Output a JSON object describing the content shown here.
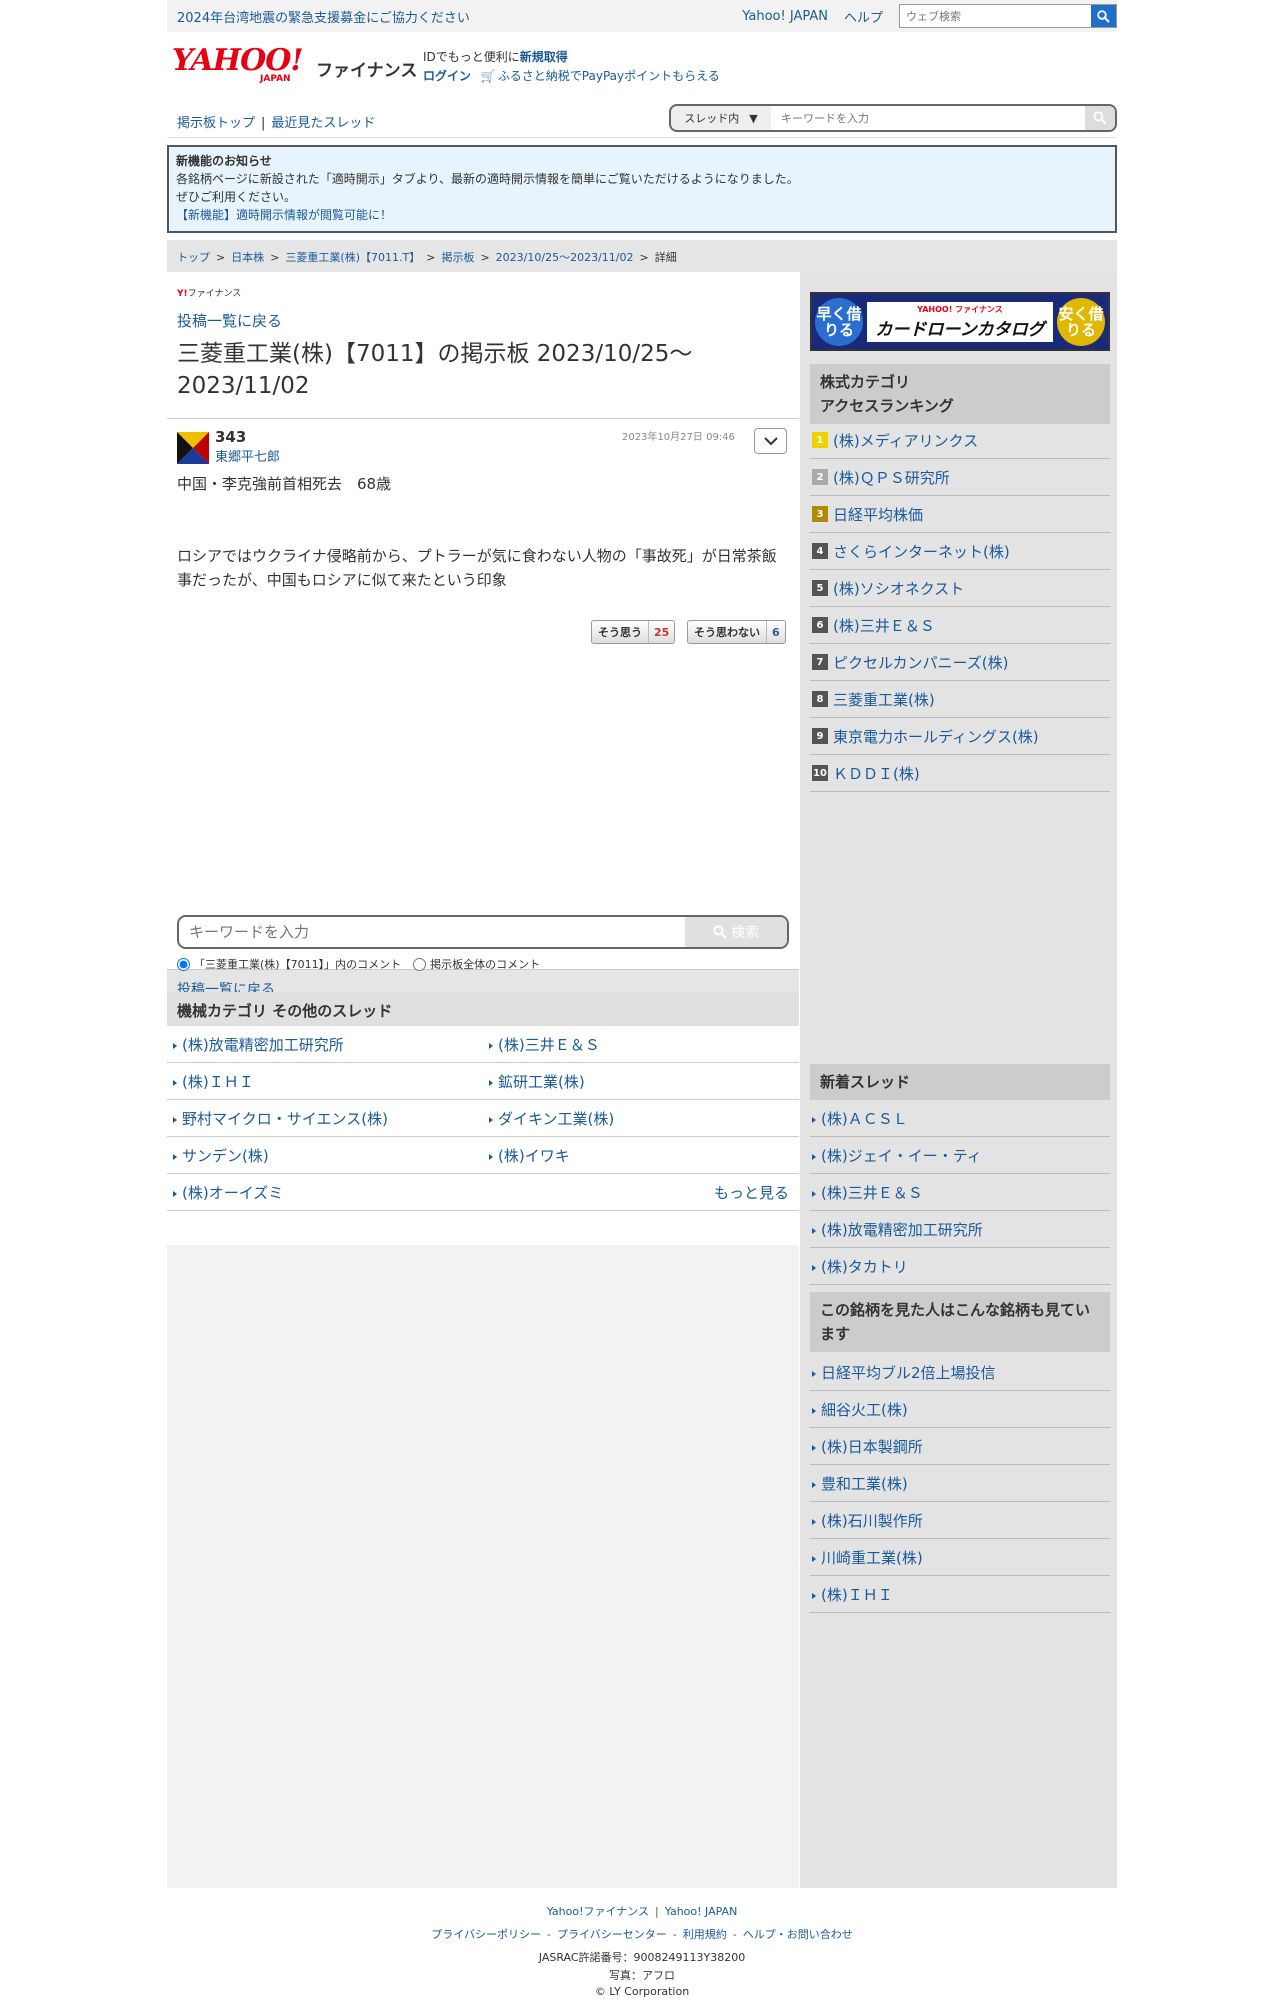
{
  "topbar": {
    "notice": "2024年台湾地震の緊急支援募金にご協力ください",
    "links": [
      "Yahoo! JAPAN",
      "ヘルプ"
    ],
    "search_placeholder": "ウェブ検索"
  },
  "header": {
    "logo_main": "YAHOO!",
    "logo_sub": "JAPAN",
    "logo_service": "ファイナンス",
    "id_text": "IDでもっと便利に",
    "signup": "新規取得",
    "login": "ログイン",
    "furusato": "ふるさと納税でPayPayポイントもらえる"
  },
  "boardnav": {
    "top": "掲示板トップ",
    "recent": "最近見たスレッド",
    "scope": "スレッド内",
    "search_placeholder": "キーワードを入力"
  },
  "announce": {
    "title": "新機能のお知らせ",
    "line1": "各銘柄ページに新設された「適時開示」タブより、最新の適時開示情報を簡単にご覧いただけるようになりました。",
    "line2": "ぜひご利用ください。",
    "link": "【新機能】適時開示情報が閲覧可能に！"
  },
  "breadcrumb": [
    "トップ",
    "日本株",
    "三菱重工業(株)【7011.T】",
    "掲示板",
    "2023/10/25〜2023/11/02",
    "詳細"
  ],
  "main": {
    "small_logo_y": "Y!",
    "small_logo_text": "ファイナンス",
    "back_link": "投稿一覧に戻る",
    "thread_title": "三菱重工業(株)【7011】の掲示板 2023/10/25〜2023/11/02"
  },
  "post": {
    "number": "343",
    "user": "東郷平七郎",
    "date": "2023年10月27日 09:46",
    "line1": "中国・李克強前首相死去　68歳",
    "body": "ロシアではウクライナ侵略前から、プトラーが気に食わない人物の「事故死」が日常茶飯事だったが、中国もロシアに似て来たという印象",
    "agree_label": "そう思う",
    "agree_count": "25",
    "disagree_label": "そう思わない",
    "disagree_count": "6"
  },
  "back_bar": "投稿一覧に戻る",
  "comment_search": {
    "placeholder": "キーワードを入力",
    "button": "検索",
    "radio1": "「三菱重工業(株)【7011】」内のコメント",
    "radio2": "掲示板全体のコメント"
  },
  "other_threads": {
    "heading": "機械カテゴリ  その他のスレッド",
    "items": [
      "(株)放電精密加工研究所",
      "(株)三井Ｅ＆Ｓ",
      "(株)ＩＨＩ",
      "鉱研工業(株)",
      "野村マイクロ・サイエンス(株)",
      "ダイキン工業(株)",
      "サンデン(株)",
      "(株)イワキ",
      "(株)オーイズミ"
    ],
    "more": "もっと見る"
  },
  "sidebar": {
    "banner_left": "早く借りる",
    "banner_brand": "YAHOO! ファイナンス",
    "banner_main": "カードローンカタログ",
    "banner_right": "安く借りる",
    "ranking_title": "株式カテゴリ\nアクセスランキング",
    "ranking_title_1": "株式カテゴリ",
    "ranking_title_2": "アクセスランキング",
    "ranking": [
      {
        "rank": "1",
        "name": "(株)メディアリンクス",
        "color": "#f0d000"
      },
      {
        "rank": "2",
        "name": "(株)ＱＰＳ研究所",
        "color": "#aaaaaa"
      },
      {
        "rank": "3",
        "name": "日経平均株価",
        "color": "#b08a00"
      },
      {
        "rank": "4",
        "name": "さくらインターネット(株)",
        "color": "#555555"
      },
      {
        "rank": "5",
        "name": "(株)ソシオネクスト",
        "color": "#555555"
      },
      {
        "rank": "6",
        "name": "(株)三井Ｅ＆Ｓ",
        "color": "#555555"
      },
      {
        "rank": "7",
        "name": "ピクセルカンパニーズ(株)",
        "color": "#555555"
      },
      {
        "rank": "8",
        "name": "三菱重工業(株)",
        "color": "#555555"
      },
      {
        "rank": "9",
        "name": "東京電力ホールディングス(株)",
        "color": "#555555"
      },
      {
        "rank": "10",
        "name": "ＫＤＤＩ(株)",
        "color": "#555555"
      }
    ],
    "new_threads_title": "新着スレッド",
    "new_threads": [
      "(株)ＡＣＳＬ",
      "(株)ジェイ・イー・ティ",
      "(株)三井Ｅ＆Ｓ",
      "(株)放電精密加工研究所",
      "(株)タカトリ"
    ],
    "also_viewed_title": "この銘柄を見た人はこんな銘柄も見ています",
    "also_viewed": [
      "日経平均ブル2倍上場投信",
      "細谷火工(株)",
      "(株)日本製鋼所",
      "豊和工業(株)",
      "(株)石川製作所",
      "川崎重工業(株)",
      "(株)ＩＨＩ"
    ]
  },
  "footer": {
    "row1": [
      "Yahoo!ファイナンス",
      "Yahoo! JAPAN"
    ],
    "row2": [
      "プライバシーポリシー",
      "プライバシーセンター",
      "利用規約",
      "ヘルプ・お問い合わせ"
    ],
    "jasrac": "JASRAC許諾番号：9008249113Y38200",
    "photo": "写真：アフロ",
    "copyright": "© LY Corporation"
  },
  "colors": {
    "link": "#1a5a9a",
    "brand": "#e60012",
    "search_btn": "#1e6fc9",
    "agree": "#c0392b",
    "disagree": "#3a4fb0"
  }
}
